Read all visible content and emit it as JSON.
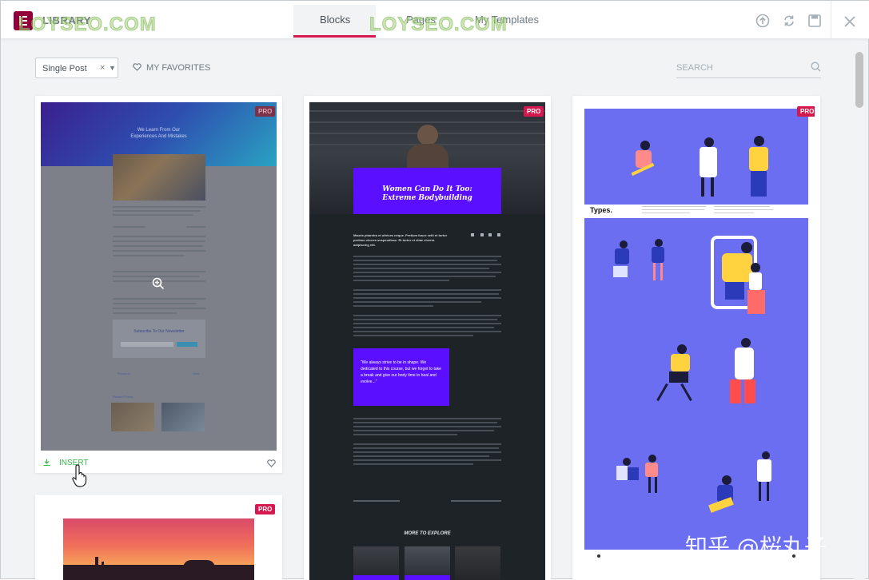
{
  "header": {
    "title": "LIBRARY",
    "tabs": [
      {
        "label": "Blocks",
        "active": true
      },
      {
        "label": "Pages",
        "active": false
      },
      {
        "label": "My Templates",
        "active": false
      }
    ],
    "icons": [
      "upload-icon",
      "sync-icon",
      "save-icon",
      "close-icon"
    ],
    "watermark": "LOYSEO.COM"
  },
  "toolbar": {
    "filter_value": "Single Post",
    "clear_symbol": "×",
    "favorites_label": "MY FAVORITES",
    "search_placeholder": "SEARCH"
  },
  "cards": [
    {
      "badge": "PRO",
      "hero_title_1": "We Learn From Our",
      "hero_title_2": "Experiences And Mistakes",
      "newsletter": "Subscribe To Our Newsletter",
      "prev_label": "Previous",
      "next_label": "Next",
      "related_label": "Related Posts",
      "insert_label": "INSERT"
    },
    {
      "badge": "PRO",
      "hero_title_1": "Women Can Do It Too:",
      "hero_title_2": "Extreme Bodybuilding",
      "lead": "Mauris pharetra et ultrices neque. Pretium fusce velit et tortor pretium viverra suspendisse. Et tortor et vitae viverra adipiscing elit.",
      "quote": "\"We always strive to be in shape. We dedicated to this course, but we forget to take a break and give our body time to heal and evolve...\"",
      "section_title": "MORE TO EXPLORE"
    },
    {
      "badge": "PRO",
      "brand": "Types."
    },
    {
      "badge": "PRO"
    }
  ],
  "colors": {
    "accent": "#d5194f",
    "logo": "#92003b",
    "insert_green": "#39b54a",
    "illustration_bg": "#6b6ef0",
    "fitness_purple": "#5a0fff"
  },
  "corner_watermark": "知乎 @桜丸子"
}
